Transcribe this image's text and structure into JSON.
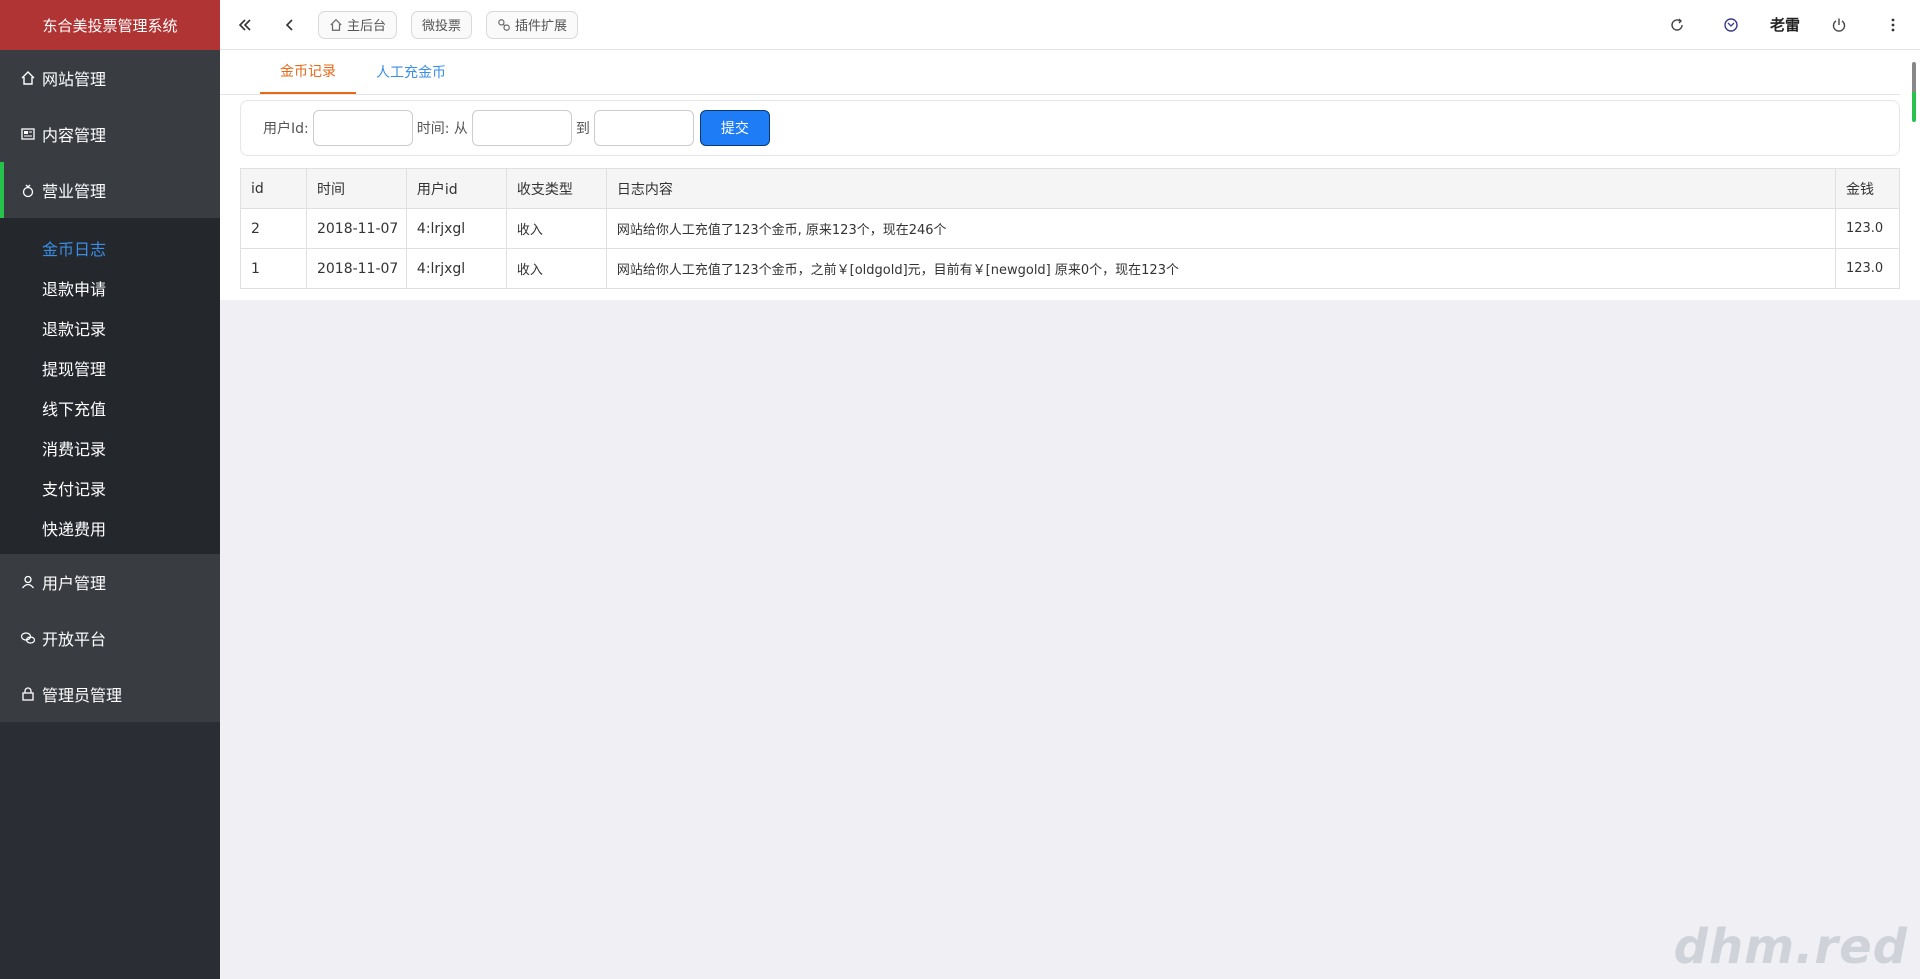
{
  "brand": "东合美投票管理系统",
  "sidebar": {
    "top_items": [
      {
        "label": "网站管理",
        "icon": "home-icon"
      },
      {
        "label": "内容管理",
        "icon": "content-icon"
      },
      {
        "label": "营业管理",
        "icon": "money-bag-icon"
      }
    ],
    "sub_items": [
      "金币日志",
      "退款申请",
      "退款记录",
      "提现管理",
      "线下充值",
      "消费记录",
      "支付记录",
      "快递费用"
    ],
    "bottom_items": [
      {
        "label": "用户管理",
        "icon": "user-icon"
      },
      {
        "label": "开放平台",
        "icon": "wechat-icon"
      },
      {
        "label": "管理员管理",
        "icon": "lock-icon"
      }
    ]
  },
  "topbar": {
    "pills": [
      "主后台",
      "微投票",
      "插件扩展"
    ],
    "user_name": "老雷"
  },
  "tabs": [
    "金币记录",
    "人工充金币"
  ],
  "filter": {
    "user_id_label": "用户Id:",
    "time_label": "时间: 从",
    "to_label": "到",
    "submit_label": "提交"
  },
  "table": {
    "headers": [
      "id",
      "时间",
      "用户id",
      "收支类型",
      "日志内容",
      "金钱"
    ],
    "rows": [
      [
        "2",
        "2018-11-07",
        "4:lrjxgl",
        "收入",
        "网站给你人工充值了123个金币, 原来123个，现在246个",
        "123.0"
      ],
      [
        "1",
        "2018-11-07",
        "4:lrjxgl",
        "收入",
        "网站给你人工充值了123个金币，之前￥[oldgold]元，目前有￥[newgold] 原来0个，现在123个",
        "123.0"
      ]
    ]
  },
  "watermark": "dhm.red",
  "colors": {
    "brand_bg": "#b03434",
    "sidebar_bg": "#2a2d33",
    "accent_green": "#27c24c",
    "link_blue": "#3a8ee6",
    "tab_active": "#e66a1a",
    "submit_blue": "#1f7cf7"
  }
}
